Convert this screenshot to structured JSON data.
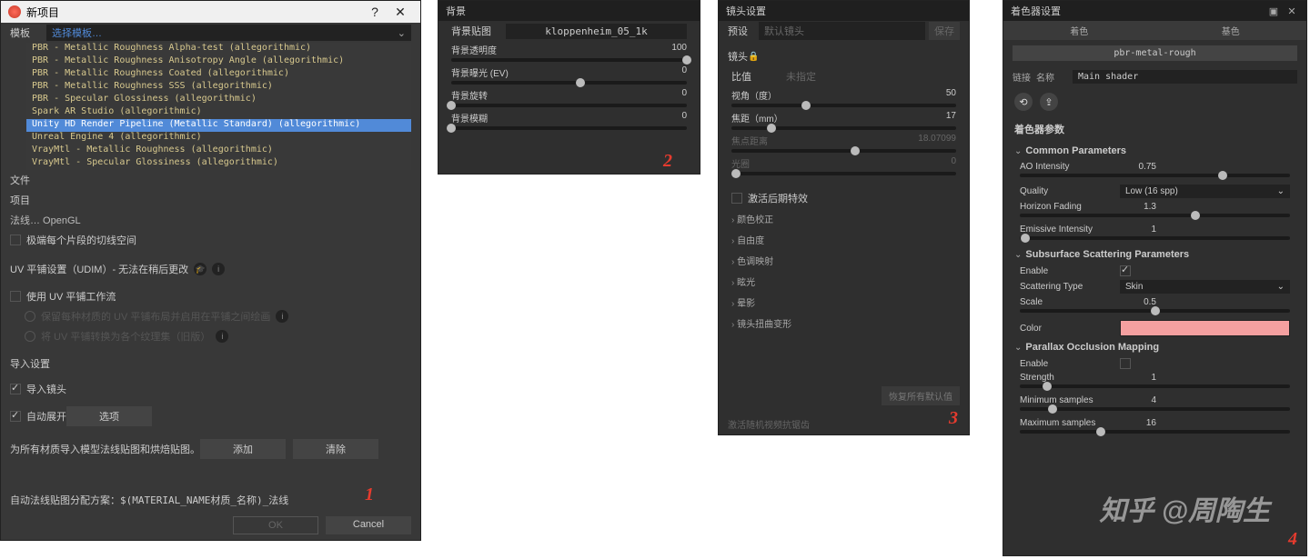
{
  "panel1": {
    "title": "新项目",
    "help": "?",
    "close": "✕",
    "row_template_label": "模板",
    "select_placeholder": "选择模板…",
    "dropdown_items": [
      {
        "label": "PBR - Metallic Roughness Alpha-test (allegorithmic)",
        "sel": false
      },
      {
        "label": "PBR - Metallic Roughness Anisotropy Angle (allegorithmic)",
        "sel": false
      },
      {
        "label": "PBR - Metallic Roughness Coated (allegorithmic)",
        "sel": false
      },
      {
        "label": "PBR - Metallic Roughness SSS (allegorithmic)",
        "sel": false
      },
      {
        "label": "PBR - Specular Glossiness (allegorithmic)",
        "sel": false
      },
      {
        "label": "Spark AR Studio (allegorithmic)",
        "sel": false
      },
      {
        "label": "Unity HD Render Pipeline (Metallic Standard) (allegorithmic)",
        "sel": true
      },
      {
        "label": "Unreal Engine 4 (allegorithmic)",
        "sel": false
      },
      {
        "label": "VrayMtl - Metallic Roughness (allegorithmic)",
        "sel": false
      },
      {
        "label": "VrayMtl - Specular Glossiness (allegorithmic)",
        "sel": false
      }
    ],
    "row_file_label": "文件",
    "row_project_label": "项目",
    "partial_line": "法线…  OpenGL",
    "tangent_space": "极端每个片段的切线空间",
    "udim_line": "UV 平铺设置（UDIM）- 无法在稍后更改",
    "use_uv_tile": "使用 UV 平铺工作流",
    "radio1": "保留每种材质的 UV 平铺布局并启用在平铺之间绘画",
    "radio2": "将 UV 平铺转换为各个纹理集（旧版）",
    "import_settings": "导入设置",
    "import_camera": "导入镜头",
    "auto_unwrap": "自动展开",
    "options_btn": "选项",
    "for_all_materials": "为所有材质导入模型法线贴图和烘焙贴图。",
    "add_btn": "添加",
    "clear_btn": "清除",
    "naming_line": "自动法线贴图分配方案：$(MATERIAL_NAME材质_名称)_法线",
    "ok_btn": "OK",
    "cancel_btn": "Cancel",
    "annotation": "1"
  },
  "panel2": {
    "title": "背景",
    "map_label": "背景贴图",
    "map_value": "kloppenheim_05_1k",
    "sliders": [
      {
        "label": "背景透明度",
        "value": "100",
        "pos": 100
      },
      {
        "label": "背景曝光 (EV)",
        "value": "0",
        "pos": 55
      },
      {
        "label": "背景旋转",
        "value": "0",
        "pos": 0
      },
      {
        "label": "背景模糊",
        "value": "0",
        "pos": 0
      }
    ],
    "annotation": "2"
  },
  "panel3": {
    "title": "镜头设置",
    "preset_label": "预设",
    "preset_placeholder": "默认镜头",
    "preset_save": "保存",
    "lens_section": "镜头",
    "ratio_label": "比值",
    "ratio_value": "未指定",
    "sliders": [
      {
        "label": "视角（度）",
        "value": "50",
        "pos": 33
      },
      {
        "label": "焦距（mm）",
        "value": "17",
        "pos": 18
      },
      {
        "label": "焦点距离",
        "value": "18.07099",
        "pos": 55,
        "muted": true
      },
      {
        "label": "光圈",
        "value": "0",
        "pos": 2,
        "muted": true
      }
    ],
    "post_fx": "激活后期特效",
    "fx_items": [
      "颜色校正",
      "自由度",
      "色调映射",
      "眩光",
      "晕影",
      "镜头扭曲变形"
    ],
    "reset_btn": "恢复所有默认值",
    "bottom_text": "激活随机视频抗锯齿",
    "annotation": "3"
  },
  "panel4": {
    "title": "着色器设置",
    "tab1": "着色",
    "tab2": "基色",
    "pill": "pbr-metal-rough",
    "link_label": "链接",
    "name_label": "名称",
    "shader_name": "Main shader",
    "params_header": "着色器参数",
    "g1_title": "Common Parameters",
    "g1": {
      "ao_intensity": {
        "label": "AO Intensity",
        "value": "0.75",
        "pos": 75
      },
      "quality": {
        "label": "Quality",
        "value": "Low (16 spp)"
      },
      "horizon_fading": {
        "label": "Horizon Fading",
        "value": "1.3",
        "pos": 65
      },
      "emissive_intensity": {
        "label": "Emissive Intensity",
        "value": "1",
        "pos": 0
      }
    },
    "g2_title": "Subsurface Scattering Parameters",
    "g2": {
      "enable": {
        "label": "Enable",
        "checked": true
      },
      "scattering_type": {
        "label": "Scattering Type",
        "value": "Skin"
      },
      "scale": {
        "label": "Scale",
        "value": "0.5",
        "pos": 50
      },
      "color": {
        "label": "Color"
      }
    },
    "g3_title": "Parallax Occlusion Mapping",
    "g3": {
      "enable": {
        "label": "Enable",
        "checked": false
      },
      "strength": {
        "label": "Strength",
        "value": "1",
        "pos": 10
      },
      "min_samples": {
        "label": "Minimum samples",
        "value": "4",
        "pos": 12
      },
      "max_samples": {
        "label": "Maximum samples",
        "value": "16",
        "pos": 30
      }
    },
    "annotation": "4"
  },
  "watermark": "知乎 @周陶生"
}
